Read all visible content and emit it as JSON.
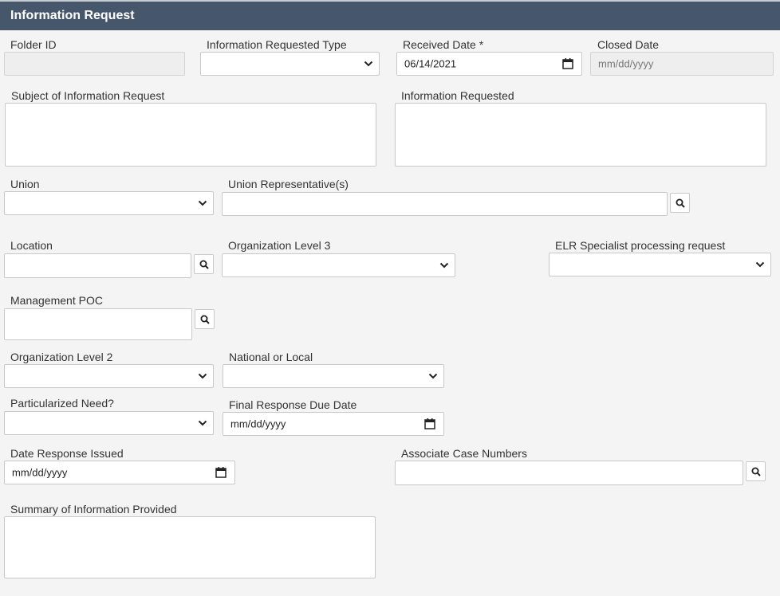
{
  "header": {
    "title": "Information Request"
  },
  "fields": {
    "folder_id": {
      "label": "Folder ID",
      "value": ""
    },
    "info_requested_type": {
      "label": "Information Requested Type",
      "value": ""
    },
    "received_date": {
      "label": "Received Date *",
      "value": "06/14/2021"
    },
    "closed_date": {
      "label": "Closed Date",
      "placeholder": "mm/dd/yyyy"
    },
    "subject": {
      "label": "Subject of Information Request",
      "value": ""
    },
    "info_requested": {
      "label": "Information Requested",
      "value": ""
    },
    "union": {
      "label": "Union",
      "value": ""
    },
    "union_rep": {
      "label": "Union Representative(s)",
      "value": ""
    },
    "location": {
      "label": "Location",
      "value": ""
    },
    "org_level3": {
      "label": "Organization Level 3",
      "value": ""
    },
    "elr_specialist": {
      "label": "ELR Specialist processing request",
      "value": ""
    },
    "management_poc": {
      "label": "Management POC",
      "value": ""
    },
    "org_level2": {
      "label": "Organization Level 2",
      "value": ""
    },
    "national_local": {
      "label": "National or Local",
      "value": ""
    },
    "particularized_need": {
      "label": "Particularized Need?",
      "value": ""
    },
    "final_response_due": {
      "label": "Final Response Due Date",
      "placeholder": "mm/dd/yyyy"
    },
    "date_response_issued": {
      "label": "Date Response Issued",
      "placeholder": "mm/dd/yyyy"
    },
    "associate_case_numbers": {
      "label": "Associate Case Numbers",
      "value": ""
    },
    "summary_info_provided": {
      "label": "Summary of Information Provided",
      "value": ""
    }
  },
  "icons": {
    "search": "search-icon",
    "dropdown": "chevron-down-icon",
    "calendar": "calendar-icon"
  }
}
